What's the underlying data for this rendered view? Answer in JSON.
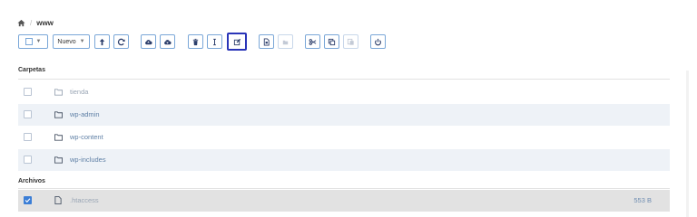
{
  "breadcrumb": {
    "path": "www"
  },
  "toolbar": {
    "new_label": "Nuevo"
  },
  "sections": {
    "folders_title": "Carpetas",
    "files_title": "Archivos"
  },
  "folders": [
    {
      "name": "tienda"
    },
    {
      "name": "wp-admin"
    },
    {
      "name": "wp-content"
    },
    {
      "name": "wp-includes"
    }
  ],
  "files": [
    {
      "name": ".htaccess",
      "size": "553 B",
      "checked": true
    }
  ],
  "icons": [
    "home-icon",
    "select-checkbox-icon",
    "chevron-down-icon",
    "upload-icon",
    "refresh-icon",
    "cloud-upload-icon",
    "cloud-download-icon",
    "trash-icon",
    "rename-icon",
    "edit-icon",
    "file-copy-icon",
    "file-disabled-icon",
    "cut-icon",
    "copy-icon",
    "paste-icon",
    "power-icon",
    "folder-icon",
    "file-icon",
    "check-icon"
  ],
  "colors": {
    "accent": "#3b7ed6",
    "active_outline": "#2a35b8",
    "row_alt": "#eef2f7",
    "row_selected": "#e2e2e2"
  }
}
